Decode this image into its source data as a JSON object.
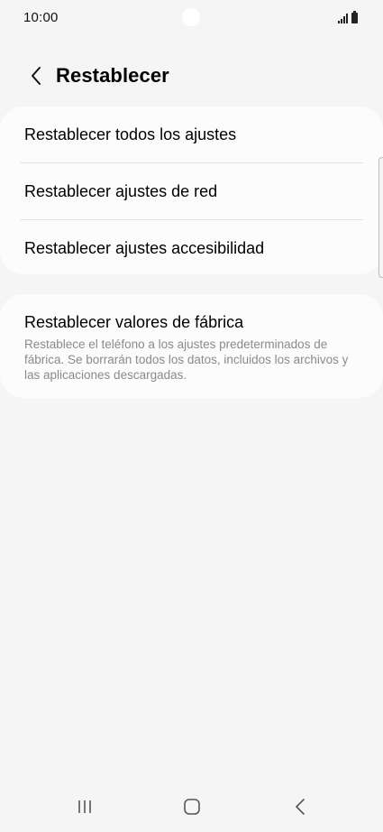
{
  "status_bar": {
    "time": "10:00",
    "icons": [
      "signal-icon",
      "battery-icon"
    ]
  },
  "header": {
    "back_icon": "chevron-left-icon",
    "title": "Restablecer"
  },
  "reset_options": {
    "items": [
      {
        "label": "Restablecer todos los ajustes"
      },
      {
        "label": "Restablecer ajustes de red"
      },
      {
        "label": "Restablecer ajustes accesibilidad"
      }
    ]
  },
  "factory_reset": {
    "title": "Restablecer valores de fábrica",
    "description": "Restablece el teléfono a los ajustes predeterminados de fábrica. Se borrarán todos los datos, incluidos los archivos y las aplicaciones descargadas."
  },
  "nav_bar": {
    "buttons": [
      "recent-apps-icon",
      "home-icon",
      "back-icon"
    ]
  },
  "colors": {
    "background": "#f5f5f5",
    "card": "#fcfcfc",
    "secondary_text": "#8a8a8a",
    "divider": "#e3e3e3"
  }
}
